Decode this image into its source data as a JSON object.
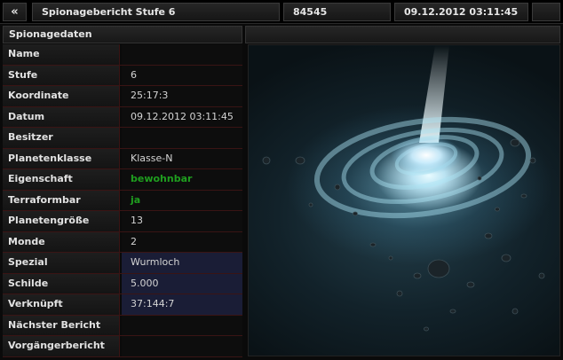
{
  "header": {
    "back_label": "«",
    "title": "Spionagebericht Stufe 6",
    "code": "84545",
    "date": "09.12.2012 03:11:45"
  },
  "section": {
    "title": "Spionagedaten"
  },
  "rows": [
    {
      "label": "Name",
      "value": ""
    },
    {
      "label": "Stufe",
      "value": "6"
    },
    {
      "label": "Koordinate",
      "value": "25:17:3"
    },
    {
      "label": "Datum",
      "value": "09.12.2012 03:11:45"
    },
    {
      "label": "Besitzer",
      "value": ""
    },
    {
      "label": "Planetenklasse",
      "value": "Klasse-N"
    },
    {
      "label": "Eigenschaft",
      "value": "bewohnbar"
    },
    {
      "label": "Terraformbar",
      "value": "ja"
    },
    {
      "label": "Planetengröße",
      "value": "13"
    },
    {
      "label": "Monde",
      "value": "2"
    },
    {
      "label": "Spezial",
      "value": "Wurmloch"
    },
    {
      "label": "Schilde",
      "value": "5.000"
    },
    {
      "label": "Verknüpft",
      "value": "37:144:7"
    },
    {
      "label": "Nächster Bericht",
      "value": ""
    },
    {
      "label": "Vorgängerbericht",
      "value": ""
    }
  ],
  "colors": {
    "highlight_bg": "#1a1d36",
    "green_text": "#1f9e1f",
    "row_border": "#3a1414"
  },
  "image": {
    "icon": "wormhole-image"
  }
}
